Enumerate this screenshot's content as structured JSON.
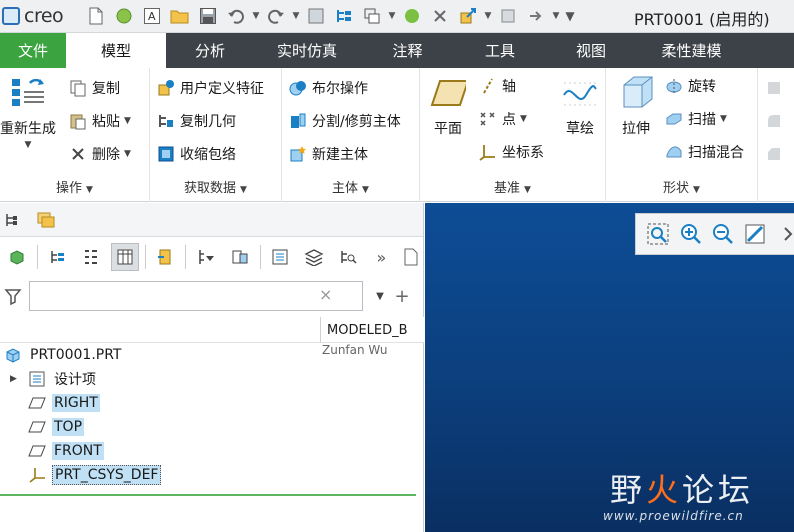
{
  "app": {
    "logo_text": "creo",
    "window_title": "PRT0001 (启用的)"
  },
  "tabs": [
    {
      "label": "文件"
    },
    {
      "label": "模型"
    },
    {
      "label": "分析"
    },
    {
      "label": "实时仿真"
    },
    {
      "label": "注释"
    },
    {
      "label": "工具"
    },
    {
      "label": "视图"
    },
    {
      "label": "柔性建模"
    }
  ],
  "ribbon": {
    "operations": {
      "label": "操作",
      "regenerate": "重新生成",
      "copy": "复制",
      "paste": "粘贴",
      "delete": "删除"
    },
    "get_data": {
      "label": "获取数据",
      "udf": "用户定义特征",
      "copy_geom": "复制几何",
      "shrinkwrap": "收缩包络"
    },
    "body": {
      "label": "主体",
      "boolean": "布尔操作",
      "split": "分割/修剪主体",
      "new_body": "新建主体"
    },
    "datum": {
      "label": "基准",
      "plane": "平面",
      "axis": "轴",
      "point": "点",
      "csys": "坐标系",
      "sketch": "草绘"
    },
    "shapes": {
      "label": "形状",
      "extrude": "拉伸",
      "revolve": "旋转",
      "sweep": "扫描",
      "swept_blend": "扫描混合"
    }
  },
  "panel": {
    "search_placeholder": "",
    "column_header": "MODELED_B",
    "column_value": "Zunfan Wu",
    "tree": [
      {
        "label": "PRT0001.PRT"
      },
      {
        "label": "设计项"
      },
      {
        "label": "RIGHT"
      },
      {
        "label": "TOP"
      },
      {
        "label": "FRONT"
      },
      {
        "label": "PRT_CSYS_DEF"
      }
    ]
  },
  "watermark": {
    "name_a": "野",
    "name_b": "火",
    "name_c": "论坛",
    "url": "www.proewildfire.cn"
  },
  "colors": {
    "file_tab": "#3ba340",
    "tab_bar": "#3c4247",
    "viewport": "#0d4d96",
    "selection": "#bfe0f5"
  }
}
